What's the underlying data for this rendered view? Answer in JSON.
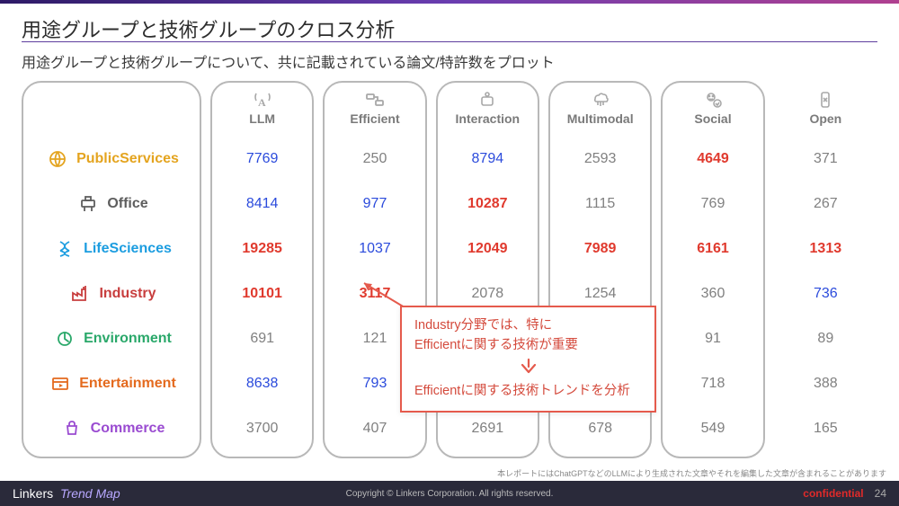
{
  "title": "用途グループと技術グループのクロス分析",
  "subtitle": "用途グループと技術グループについて、共に記載されている論文/特許数をプロット",
  "columns": [
    "LLM",
    "Efficient",
    "Interaction",
    "Multimodal",
    "Social",
    "Open"
  ],
  "rows": [
    {
      "key": "publicservices",
      "label": "PublicServices"
    },
    {
      "key": "office",
      "label": "Office"
    },
    {
      "key": "lifesciences",
      "label": "LifeSciences"
    },
    {
      "key": "industry",
      "label": "Industry"
    },
    {
      "key": "environment",
      "label": "Environment"
    },
    {
      "key": "entertainment",
      "label": "Entertainment"
    },
    {
      "key": "commerce",
      "label": "Commerce"
    }
  ],
  "cells": {
    "publicservices": {
      "LLM": {
        "v": "7769",
        "c": "blue"
      },
      "Efficient": {
        "v": "250",
        "c": ""
      },
      "Interaction": {
        "v": "8794",
        "c": "blue"
      },
      "Multimodal": {
        "v": "2593",
        "c": ""
      },
      "Social": {
        "v": "4649",
        "c": "red"
      },
      "Open": {
        "v": "371",
        "c": ""
      }
    },
    "office": {
      "LLM": {
        "v": "8414",
        "c": "blue"
      },
      "Efficient": {
        "v": "977",
        "c": "blue"
      },
      "Interaction": {
        "v": "10287",
        "c": "red"
      },
      "Multimodal": {
        "v": "1115",
        "c": ""
      },
      "Social": {
        "v": "769",
        "c": ""
      },
      "Open": {
        "v": "267",
        "c": ""
      }
    },
    "lifesciences": {
      "LLM": {
        "v": "19285",
        "c": "red"
      },
      "Efficient": {
        "v": "1037",
        "c": "blue"
      },
      "Interaction": {
        "v": "12049",
        "c": "red"
      },
      "Multimodal": {
        "v": "7989",
        "c": "red"
      },
      "Social": {
        "v": "6161",
        "c": "red"
      },
      "Open": {
        "v": "1313",
        "c": "red"
      }
    },
    "industry": {
      "LLM": {
        "v": "10101",
        "c": "red"
      },
      "Efficient": {
        "v": "3117",
        "c": "red"
      },
      "Interaction": {
        "v": "2078",
        "c": ""
      },
      "Multimodal": {
        "v": "1254",
        "c": ""
      },
      "Social": {
        "v": "360",
        "c": ""
      },
      "Open": {
        "v": "736",
        "c": "blue"
      }
    },
    "environment": {
      "LLM": {
        "v": "691",
        "c": ""
      },
      "Efficient": {
        "v": "121",
        "c": ""
      },
      "Interaction": {
        "v": "",
        "c": ""
      },
      "Multimodal": {
        "v": "",
        "c": ""
      },
      "Social": {
        "v": "91",
        "c": ""
      },
      "Open": {
        "v": "89",
        "c": ""
      }
    },
    "entertainment": {
      "LLM": {
        "v": "8638",
        "c": "blue"
      },
      "Efficient": {
        "v": "793",
        "c": "blue"
      },
      "Interaction": {
        "v": "",
        "c": ""
      },
      "Multimodal": {
        "v": "",
        "c": ""
      },
      "Social": {
        "v": "718",
        "c": ""
      },
      "Open": {
        "v": "388",
        "c": ""
      }
    },
    "commerce": {
      "LLM": {
        "v": "3700",
        "c": ""
      },
      "Efficient": {
        "v": "407",
        "c": ""
      },
      "Interaction": {
        "v": "2691",
        "c": ""
      },
      "Multimodal": {
        "v": "678",
        "c": ""
      },
      "Social": {
        "v": "549",
        "c": ""
      },
      "Open": {
        "v": "165",
        "c": ""
      }
    }
  },
  "callout": {
    "line1": "Industry分野では、特に",
    "line2": "Efficientに関する技術が重要",
    "line3": "Efficientに関する技術トレンドを分析"
  },
  "disclaimer": "本レポートにはChatGPTなどのLLMにより生成された文章やそれを編集した文章が含まれることがあります",
  "footer": {
    "brand1": "Linkers",
    "brand2": "Trend Map",
    "copyright": "Copyright © Linkers Corporation. All rights reserved.",
    "confidential": "confidential",
    "page": "24"
  },
  "chart_data": {
    "type": "table",
    "title": "用途グループと技術グループのクロス分析",
    "columns": [
      "LLM",
      "Efficient",
      "Interaction",
      "Multimodal",
      "Social",
      "Open"
    ],
    "rows": [
      "PublicServices",
      "Office",
      "LifeSciences",
      "Industry",
      "Environment",
      "Entertainment",
      "Commerce"
    ],
    "values": [
      [
        7769,
        250,
        8794,
        2593,
        4649,
        371
      ],
      [
        8414,
        977,
        10287,
        1115,
        769,
        267
      ],
      [
        19285,
        1037,
        12049,
        7989,
        6161,
        1313
      ],
      [
        10101,
        3117,
        2078,
        1254,
        360,
        736
      ],
      [
        691,
        121,
        null,
        null,
        91,
        89
      ],
      [
        8638,
        793,
        null,
        null,
        718,
        388
      ],
      [
        3700,
        407,
        2691,
        678,
        549,
        165
      ]
    ],
    "highlight": {
      "red_bold": [
        [
          2,
          0
        ],
        [
          2,
          2
        ],
        [
          2,
          3
        ],
        [
          2,
          4
        ],
        [
          2,
          5
        ],
        [
          3,
          0
        ],
        [
          3,
          1
        ],
        [
          1,
          2
        ],
        [
          0,
          4
        ]
      ],
      "blue": [
        [
          0,
          0
        ],
        [
          0,
          2
        ],
        [
          1,
          0
        ],
        [
          1,
          1
        ],
        [
          2,
          1
        ],
        [
          5,
          0
        ],
        [
          5,
          1
        ],
        [
          3,
          5
        ]
      ]
    }
  }
}
